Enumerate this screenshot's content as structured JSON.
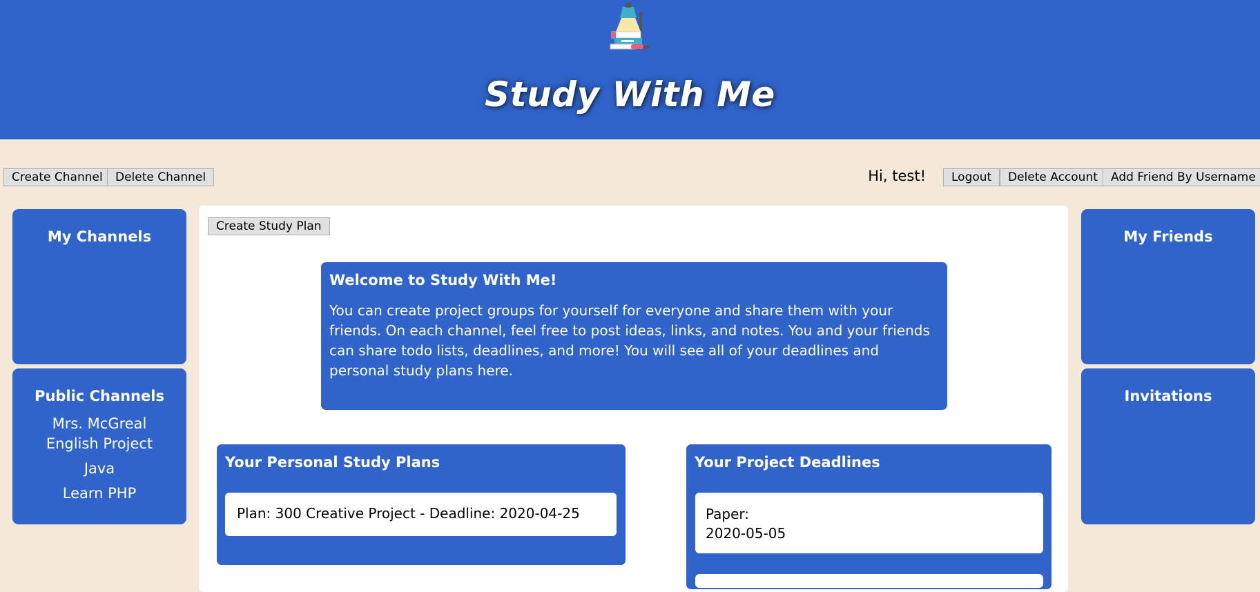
{
  "header": {
    "title": "Study With Me",
    "logo": "desk-lamp-books-logo"
  },
  "toolbar": {
    "create_channel": "Create Channel",
    "delete_channel": "Delete Channel",
    "greeting": "Hi, test!",
    "logout": "Logout",
    "delete_account": "Delete Account",
    "add_friend": "Add Friend By Username"
  },
  "sidebar_left": {
    "my_channels": {
      "title": "My Channels",
      "items": []
    },
    "public_channels": {
      "title": "Public Channels",
      "items": [
        "Mrs. McGreal English Project",
        "Java",
        "Learn PHP"
      ]
    }
  },
  "main": {
    "create_study_plan": "Create Study Plan",
    "welcome": {
      "title": "Welcome to Study With Me!",
      "body": "You can create project groups for yourself for everyone and share them with your friends. On each channel, feel free to post ideas, links, and notes. You and your friends can share todo lists, deadlines, and more! You will see all of your deadlines and personal study plans here."
    },
    "study_plans": {
      "title": "Your Personal Study Plans",
      "items": [
        "Plan: 300 Creative Project - Deadline: 2020-04-25"
      ]
    },
    "deadlines": {
      "title": "Your Project Deadlines",
      "items": [
        {
          "name": "Paper:",
          "date": "2020-05-05"
        }
      ]
    }
  },
  "sidebar_right": {
    "my_friends": {
      "title": "My Friends",
      "items": []
    },
    "invitations": {
      "title": "Invitations",
      "items": []
    }
  },
  "colors": {
    "primary": "#3064cb",
    "background": "#f4e9d8",
    "panel_text": "#ffffff"
  }
}
